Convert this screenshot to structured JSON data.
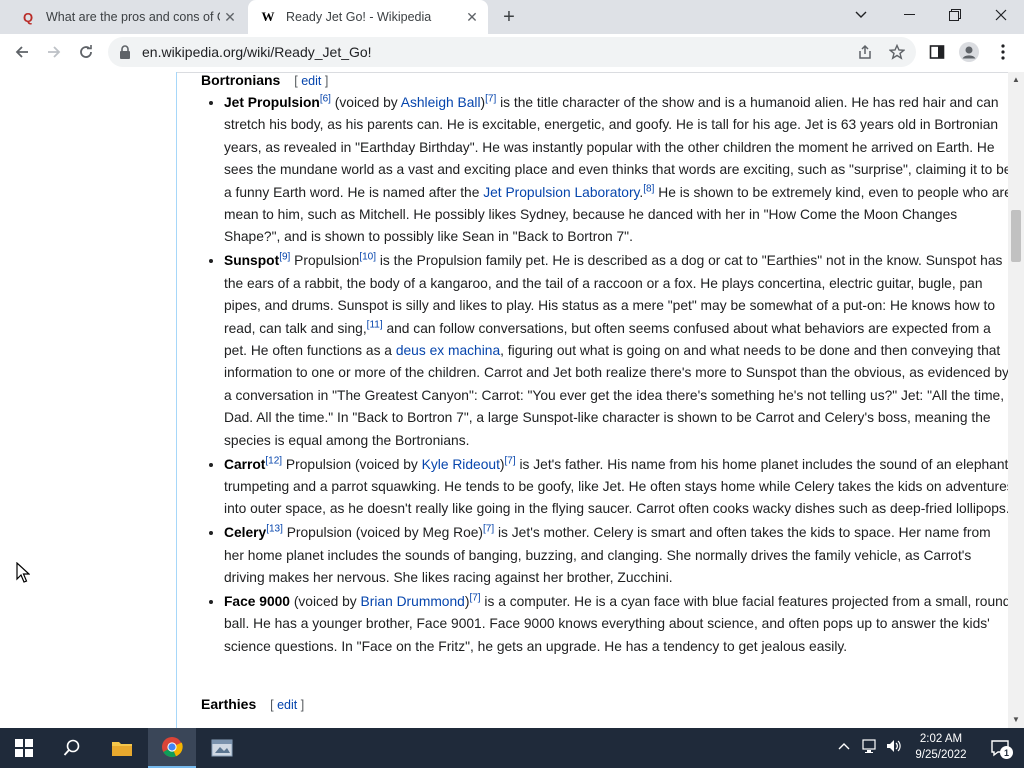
{
  "browser": {
    "tabs": [
      {
        "title": "What are the pros and cons of G",
        "favicon": "Q"
      },
      {
        "title": "Ready Jet Go! - Wikipedia",
        "favicon": "W"
      }
    ],
    "url": "en.wikipedia.org/wiki/Ready_Jet_Go!"
  },
  "article": {
    "section1": {
      "title": "Bortronians",
      "edit": "edit"
    },
    "section2": {
      "title": "Earthies",
      "edit": "edit"
    },
    "characters": [
      {
        "name": "Jet Propulsion",
        "parts": [
          {
            "t": "sup",
            "v": "[6]"
          },
          {
            "t": "text",
            "v": " (voiced by "
          },
          {
            "t": "link",
            "v": "Ashleigh Ball"
          },
          {
            "t": "text",
            "v": ")"
          },
          {
            "t": "sup",
            "v": "[7]"
          },
          {
            "t": "text",
            "v": " is the title character of the show and is a humanoid alien. He has red hair and can stretch his body, as his parents can. He is excitable, energetic, and goofy. He is tall for his age. Jet is 63 years old in Bortronian years, as revealed in \"Earthday Birthday\". He was instantly popular with the other children the moment he arrived on Earth. He sees the mundane world as a vast and exciting place and even thinks that words are exciting, such as \"surprise\", claiming it to be a funny Earth word. He is named after the "
          },
          {
            "t": "link",
            "v": "Jet Propulsion Laboratory"
          },
          {
            "t": "text",
            "v": "."
          },
          {
            "t": "sup",
            "v": "[8]"
          },
          {
            "t": "text",
            "v": " He is shown to be extremely kind, even to people who are mean to him, such as Mitchell. He possibly likes Sydney, because he danced with her in \"How Come the Moon Changes Shape?\", and is shown to possibly like Sean in \"Back to Bortron 7\"."
          }
        ]
      },
      {
        "name": "Sunspot",
        "parts": [
          {
            "t": "sup",
            "v": "[9]"
          },
          {
            "t": "text",
            "v": " Propulsion"
          },
          {
            "t": "sup",
            "v": "[10]"
          },
          {
            "t": "text",
            "v": " is the Propulsion family pet. He is described as a dog or cat to \"Earthies\" not in the know. Sunspot has the ears of a rabbit, the body of a kangaroo, and the tail of a raccoon or a fox. He plays concertina, electric guitar, bugle, pan pipes, and drums. Sunspot is silly and likes to play. His status as a mere \"pet\" may be somewhat of a put-on: He knows how to read, can talk and sing,"
          },
          {
            "t": "sup",
            "v": "[11]"
          },
          {
            "t": "text",
            "v": " and can follow conversations, but often seems confused about what behaviors are expected from a pet. He often functions as a "
          },
          {
            "t": "link",
            "v": "deus ex machina"
          },
          {
            "t": "text",
            "v": ", figuring out what is going on and what needs to be done and then conveying that information to one or more of the children. Carrot and Jet both realize there's more to Sunspot than the obvious, as evidenced by a conversation in \"The Greatest Canyon\": Carrot: \"You ever get the idea there's something he's not telling us?\" Jet: \"All the time, Dad. All the time.\" In \"Back to Bortron 7\", a large Sunspot-like character is shown to be Carrot and Celery's boss, meaning the species is equal among the Bortronians."
          }
        ]
      },
      {
        "name": "Carrot",
        "parts": [
          {
            "t": "sup",
            "v": "[12]"
          },
          {
            "t": "text",
            "v": " Propulsion (voiced by "
          },
          {
            "t": "link",
            "v": "Kyle Rideout"
          },
          {
            "t": "text",
            "v": ")"
          },
          {
            "t": "sup",
            "v": "[7]"
          },
          {
            "t": "text",
            "v": " is Jet's father. His name from his home planet includes the sound of an elephant trumpeting and a parrot squawking. He tends to be goofy, like Jet. He often stays home while Celery takes the kids on adventures into outer space, as he doesn't really like going in the flying saucer. Carrot often cooks wacky dishes such as deep-fried lollipops."
          }
        ]
      },
      {
        "name": "Celery",
        "parts": [
          {
            "t": "sup",
            "v": "[13]"
          },
          {
            "t": "text",
            "v": " Propulsion (voiced by Meg Roe)"
          },
          {
            "t": "sup",
            "v": "[7]"
          },
          {
            "t": "text",
            "v": " is Jet's mother. Celery is smart and often takes the kids to space. Her name from her home planet includes the sounds of banging, buzzing, and clanging. She normally drives the family vehicle, as Carrot's driving makes her nervous. She likes racing against her brother, Zucchini."
          }
        ]
      },
      {
        "name": "Face 9000",
        "parts": [
          {
            "t": "text",
            "v": " (voiced by "
          },
          {
            "t": "link",
            "v": "Brian Drummond"
          },
          {
            "t": "text",
            "v": ")"
          },
          {
            "t": "sup",
            "v": "[7]"
          },
          {
            "t": "text",
            "v": " is a computer. He is a cyan face with blue facial features projected from a small, round ball. He has a younger brother, Face 9001. Face 9000 knows everything about science, and often pops up to answer the kids' science questions. In \"Face on the Fritz\", he gets an upgrade. He has a tendency to get jealous easily."
          }
        ]
      }
    ]
  },
  "taskbar": {
    "time": "2:02 AM",
    "date": "9/25/2022",
    "notification_count": "1"
  }
}
